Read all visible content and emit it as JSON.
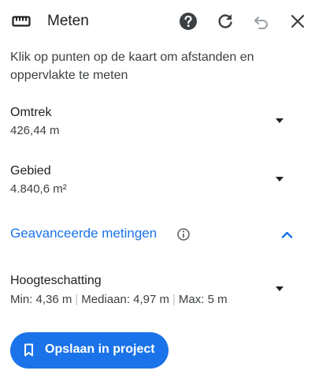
{
  "header": {
    "title": "Meten",
    "icons": {
      "tool": "ruler-icon",
      "help": "help-icon",
      "refresh": "refresh-icon",
      "undo": "undo-icon",
      "close": "close-icon"
    }
  },
  "instructions": "Klik op punten op de kaart om afstanden en oppervlakte te meten",
  "perimeter": {
    "label": "Omtrek",
    "value": "426,44 m"
  },
  "area": {
    "label": "Gebied",
    "value": "4.840,6 m²"
  },
  "advanced": {
    "label": "Geavanceerde metingen",
    "expanded": true
  },
  "height": {
    "label": "Hoogteschatting",
    "min": "Min: 4,36 m",
    "median": "Mediaan: 4,97 m",
    "max": "Max: 5 m",
    "separator": "|"
  },
  "save_button": {
    "label": "Opslaan in project"
  },
  "colors": {
    "accent": "#1a73e8",
    "text": "#202124",
    "secondary_text": "#3c4043"
  }
}
